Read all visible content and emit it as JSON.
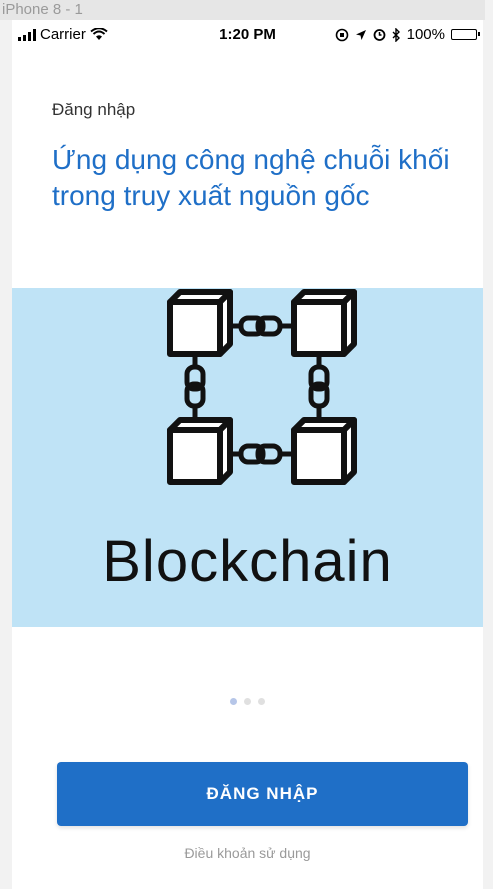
{
  "frame_label": "iPhone 8 - 1",
  "status_bar": {
    "carrier": "Carrier",
    "time": "1:20 PM",
    "battery": "100%"
  },
  "subtitle": "Đăng nhập",
  "headline": "Ứng dụng công nghệ chuỗi khối trong truy xuất nguồn gốc",
  "banner": {
    "word": "Blockchain",
    "background": "#bfe3f6"
  },
  "pager": {
    "count": 3,
    "active": 0
  },
  "login_button": "ĐĂNG NHẬP",
  "terms_link": "Điều khoản sử dụng",
  "colors": {
    "primary": "#1f6fc7"
  }
}
